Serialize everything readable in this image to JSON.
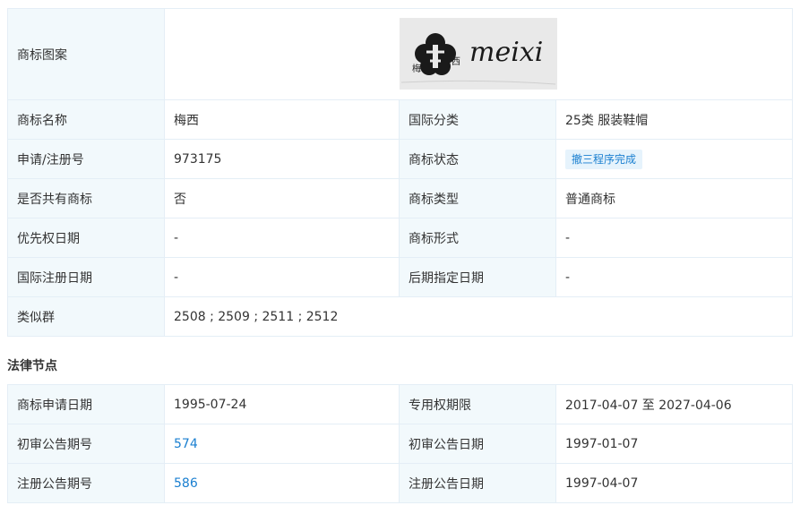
{
  "info": {
    "logo_label": "商标图案",
    "logo_text": "meixi",
    "logo_mark_left": "梅",
    "logo_mark_right": "西",
    "name_label": "商标名称",
    "name_value": "梅西",
    "class_label": "国际分类",
    "class_value": "25类 服装鞋帽",
    "reg_no_label": "申请/注册号",
    "reg_no_value": "973175",
    "status_label": "商标状态",
    "status_value": "撤三程序完成",
    "shared_label": "是否共有商标",
    "shared_value": "否",
    "type_label": "商标类型",
    "type_value": "普通商标",
    "priority_label": "优先权日期",
    "priority_value": "-",
    "form_label": "商标形式",
    "form_value": "-",
    "intl_reg_label": "国际注册日期",
    "intl_reg_value": "-",
    "later_label": "后期指定日期",
    "later_value": "-",
    "similar_label": "类似群",
    "similar_value": "2508 ; 2509 ; 2511 ; 2512"
  },
  "legal": {
    "section_title": "法律节点",
    "apply_date_label": "商标申请日期",
    "apply_date_value": "1995-07-24",
    "exclusive_label": "专用权期限",
    "exclusive_value": "2017-04-07 至 2027-04-06",
    "prelim_no_label": "初审公告期号",
    "prelim_no_value": "574",
    "prelim_date_label": "初审公告日期",
    "prelim_date_value": "1997-01-07",
    "reg_no_label": "注册公告期号",
    "reg_no_value": "586",
    "reg_date_label": "注册公告日期",
    "reg_date_value": "1997-04-07"
  },
  "colors": {
    "label_bg": "#f2f9fc",
    "border": "#e4eef6",
    "link": "#1a7fd0",
    "badge_bg": "#e6f3fc"
  }
}
